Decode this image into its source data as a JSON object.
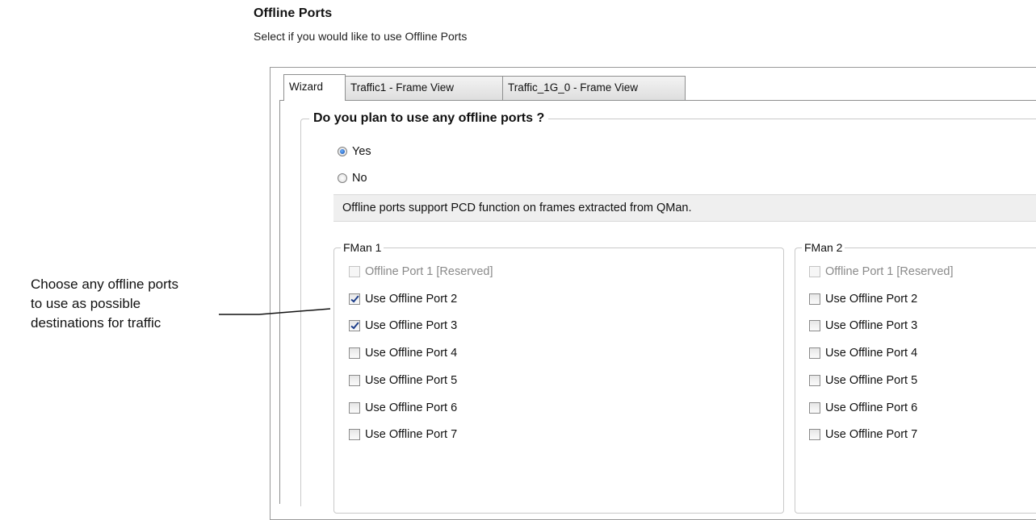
{
  "header": {
    "title": "Offline Ports",
    "subtitle": "Select if you would like to use Offline Ports"
  },
  "tabs": [
    {
      "label": "Wizard",
      "active": true
    },
    {
      "label": "Traffic1 - Frame View",
      "active": false
    },
    {
      "label": "Traffic_1G_0 - Frame View",
      "active": false
    }
  ],
  "plan_group": {
    "legend": "Do you plan to use any offline ports ?",
    "options": [
      {
        "label": "Yes",
        "selected": true
      },
      {
        "label": "No",
        "selected": false
      }
    ],
    "info": "Offline ports support PCD function on frames extracted from QMan."
  },
  "fman1": {
    "label": "FMan 1",
    "ports": [
      {
        "label": "Offline Port 1 [Reserved]",
        "checked": false,
        "disabled": true
      },
      {
        "label": "Use Offline Port 2",
        "checked": true,
        "disabled": false
      },
      {
        "label": "Use Offline Port 3",
        "checked": true,
        "disabled": false
      },
      {
        "label": "Use Offline Port 4",
        "checked": false,
        "disabled": false
      },
      {
        "label": "Use Offline Port 5",
        "checked": false,
        "disabled": false
      },
      {
        "label": "Use Offline Port 6",
        "checked": false,
        "disabled": false
      },
      {
        "label": "Use Offline Port 7",
        "checked": false,
        "disabled": false
      }
    ]
  },
  "fman2": {
    "label": "FMan 2",
    "ports": [
      {
        "label": "Offline Port 1 [Reserved]",
        "checked": false,
        "disabled": true
      },
      {
        "label": "Use Offline Port 2",
        "checked": false,
        "disabled": false
      },
      {
        "label": "Use Offline Port 3",
        "checked": false,
        "disabled": false
      },
      {
        "label": "Use Offline Port 4",
        "checked": false,
        "disabled": false
      },
      {
        "label": "Use Offline Port 5",
        "checked": false,
        "disabled": false
      },
      {
        "label": "Use Offline Port 6",
        "checked": false,
        "disabled": false
      },
      {
        "label": "Use Offline Port 7",
        "checked": false,
        "disabled": false
      }
    ]
  },
  "annotation": {
    "lines": [
      "Choose any offline ports",
      "to use as possible",
      "destinations for traffic"
    ]
  },
  "colors": {
    "check_mark": "#1d3e8a",
    "radio_selected": "#0a46a8",
    "banner_bg": "#efefef"
  }
}
